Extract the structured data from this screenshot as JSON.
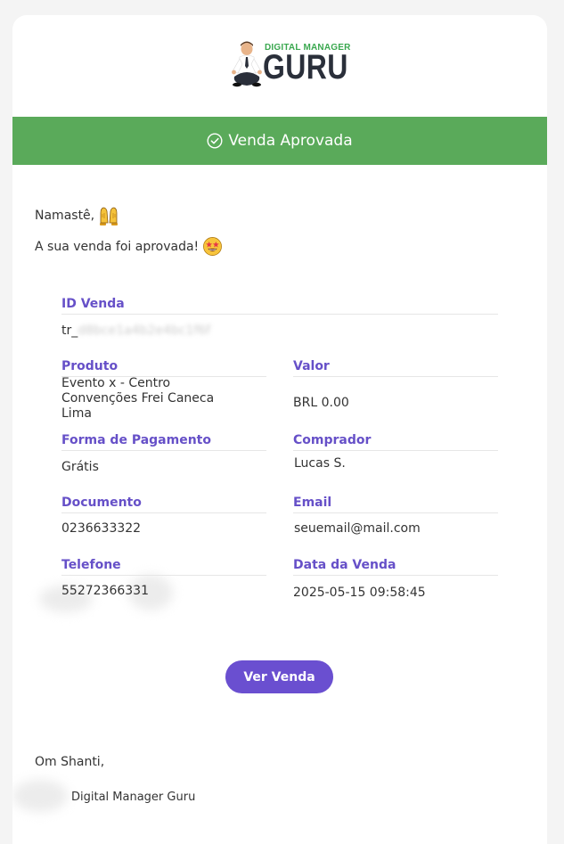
{
  "logo": {
    "line1": "DIGITAL MANAGER",
    "line2": "GURU"
  },
  "banner": {
    "title": "Venda Aprovada",
    "icon": "check-circle-icon"
  },
  "greeting": {
    "text": "Namastê,",
    "emoji": "raised-hands-emoji"
  },
  "message": {
    "text": "A sua venda foi aprovada!",
    "emoji": "star-struck-emoji"
  },
  "fields": {
    "id_venda": {
      "label": "ID Venda",
      "value_prefix": "tr_",
      "value_redacted": "d8bce1a4b2e4bc1f6f"
    },
    "produto": {
      "label": "Produto",
      "value": "Evento x - Centro Convenções Frei Caneca Lima"
    },
    "valor": {
      "label": "Valor",
      "value": "BRL 0.00"
    },
    "forma_pagamento": {
      "label": "Forma de Pagamento",
      "value": "Grátis"
    },
    "comprador": {
      "label": "Comprador",
      "value": "Lucas S."
    },
    "documento": {
      "label": "Documento",
      "value": "0236633322"
    },
    "email": {
      "label": "Email",
      "value": "seuemail@mail.com"
    },
    "telefone": {
      "label": "Telefone",
      "value": "55272366331"
    },
    "data_venda": {
      "label": "Data da Venda",
      "value": "2025-05-15 09:58:45"
    }
  },
  "button": {
    "label": "Ver Venda"
  },
  "footer": {
    "signoff": "Om Shanti,",
    "signature": "Digital Manager Guru"
  },
  "colors": {
    "banner": "#5aaa5a",
    "accent": "#6650c8",
    "button": "#6a4fd0"
  }
}
